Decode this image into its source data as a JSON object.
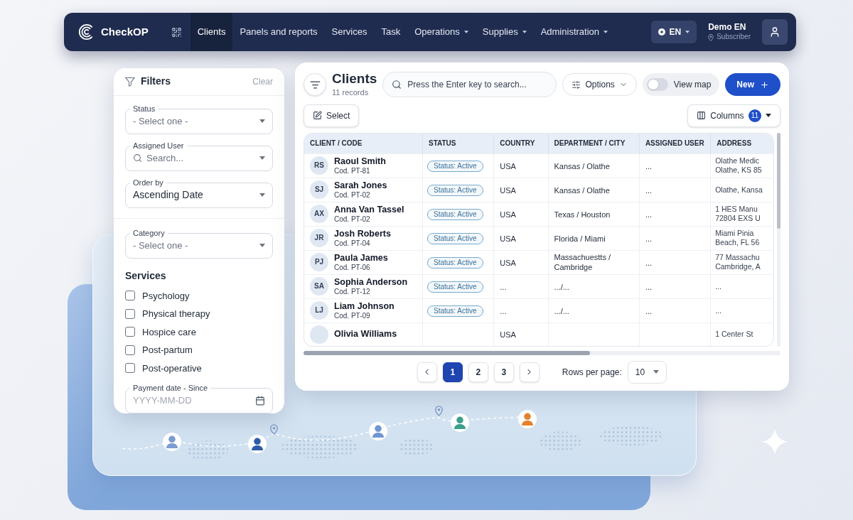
{
  "navbar": {
    "logo": "CheckOP",
    "tabs": [
      {
        "label": "Clients",
        "selected": true,
        "dropdown": false
      },
      {
        "label": "Panels and reports",
        "selected": false,
        "dropdown": false
      },
      {
        "label": "Services",
        "selected": false,
        "dropdown": false
      },
      {
        "label": "Task",
        "selected": false,
        "dropdown": false
      },
      {
        "label": "Operations",
        "selected": false,
        "dropdown": true
      },
      {
        "label": "Supplies",
        "selected": false,
        "dropdown": true
      },
      {
        "label": "Administration",
        "selected": false,
        "dropdown": true
      }
    ],
    "language": "EN",
    "user": {
      "name": "Demo EN",
      "role": "Subscriber"
    }
  },
  "filters": {
    "title": "Filters",
    "clear": "Clear",
    "fields": [
      {
        "kind": "select",
        "label": "Status",
        "placeholder": "- Select one -"
      },
      {
        "kind": "search",
        "label": "Assigned User",
        "placeholder": "Search..."
      },
      {
        "kind": "select",
        "label": "Order by",
        "value": "Ascending Date"
      }
    ],
    "category": {
      "kind": "select",
      "label": "Category",
      "placeholder": "- Select one -"
    },
    "services": {
      "title": "Services",
      "options": [
        {
          "label": "Psychology",
          "checked": false
        },
        {
          "label": "Physical therapy",
          "checked": false
        },
        {
          "label": "Hospice care",
          "checked": false
        },
        {
          "label": "Post-partum",
          "checked": false
        },
        {
          "label": "Post-operative",
          "checked": false
        }
      ]
    },
    "payment_date": {
      "kind": "date",
      "label": "Payment date - Since",
      "placeholder": "YYYY-MM-DD"
    }
  },
  "clients": {
    "title": "Clients",
    "count": "11 records",
    "search": {
      "placeholder": "Press the Enter key to search..."
    },
    "options": "Options",
    "view_map": {
      "label": "View map",
      "on": false
    },
    "new": "New",
    "select": "Select",
    "columns": {
      "label": "Columns",
      "count": "11"
    },
    "table": {
      "columns": [
        "CLIENT / CODE",
        "STATUS",
        "COUNTRY",
        "DEPARTMENT / CITY",
        "ASSIGNED USER",
        "ADDRESS"
      ],
      "rows": [
        {
          "initials": "RS",
          "name": "Raoul Smith",
          "code": "Cod. PT-81",
          "status": "Status: Active",
          "country": "USA",
          "city": "Kansas / Olathe",
          "assigned_user": "...",
          "address": [
            "Olathe Medic",
            "Olathe, KS 85"
          ]
        },
        {
          "initials": "SJ",
          "name": "Sarah Jones",
          "code": "Cod. PT-02",
          "status": "Status: Active",
          "country": "USA",
          "city": "Kansas / Olathe",
          "assigned_user": "...",
          "address": [
            "Olathe, Kansa"
          ]
        },
        {
          "initials": "AX",
          "name": "Anna Van Tassel",
          "code": "Cod. PT-02",
          "status": "Status: Active",
          "country": "USA",
          "city": "Texas / Houston",
          "assigned_user": "...",
          "address": [
            "1 HES Manu",
            "72804 EXS U"
          ]
        },
        {
          "initials": "JR",
          "name": "Josh Roberts",
          "code": "Cod. PT-04",
          "status": "Status: Active",
          "country": "USA",
          "city": "Florida / Miami",
          "assigned_user": "...",
          "address": [
            "Miami Pinia",
            "Beach, FL 56"
          ]
        },
        {
          "initials": "PJ",
          "name": "Paula James",
          "code": "Cod. PT-06",
          "status": "Status: Active",
          "country": "USA",
          "city": "Massachuestts / Cambridge",
          "assigned_user": "...",
          "address": [
            "77 Massachu",
            "Cambridge, A"
          ]
        },
        {
          "initials": "SA",
          "name": "Sophia Anderson",
          "code": "Cod. PT-12",
          "status": "Status: Active",
          "country": "...",
          "city": ".../...",
          "assigned_user": "...",
          "address": [
            "..."
          ]
        },
        {
          "initials": "LJ",
          "name": "Liam Johnson",
          "code": "Cod. PT-09",
          "status": "Status: Active",
          "country": "...",
          "city": ".../...",
          "assigned_user": "...",
          "address": [
            "..."
          ]
        },
        {
          "name": "Olivia Williams",
          "country": "USA",
          "address": [
            "1 Center St"
          ]
        }
      ]
    },
    "pagination": {
      "pages": [
        {
          "label": "1",
          "selected": true
        },
        {
          "label": "2",
          "selected": false
        },
        {
          "label": "3",
          "selected": false
        }
      ],
      "rows_per_page_label": "Rows per page:",
      "rows_per_page": "10"
    }
  },
  "map_pins": [
    {
      "color": "#7b9cd2"
    },
    {
      "color": "#2d5ca6"
    },
    {
      "color": "#7097d0"
    },
    {
      "color": "#3c9f8c"
    },
    {
      "color": "#e5822f"
    }
  ]
}
